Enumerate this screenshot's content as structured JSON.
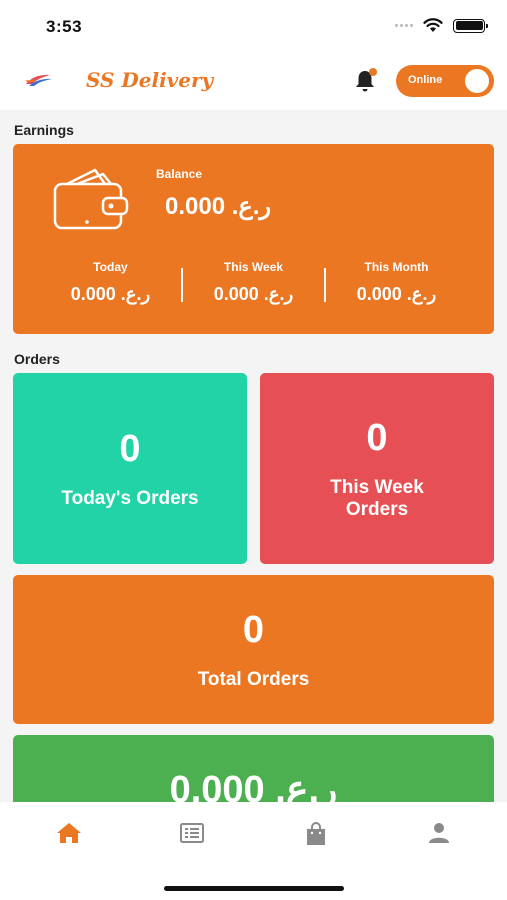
{
  "status_bar": {
    "time": "3:53"
  },
  "header": {
    "app_title": "SS Delivery",
    "online_toggle": {
      "label": "Online",
      "state": "on"
    },
    "notification_badge": true
  },
  "earnings": {
    "section_label": "Earnings",
    "balance_label": "Balance",
    "balance_value": "0.000 .ر.ع",
    "periods": [
      {
        "label": "Today",
        "value": "0.000 .ر.ع"
      },
      {
        "label": "This Week",
        "value": "0.000 .ر.ع"
      },
      {
        "label": "This Month",
        "value": "0.000 .ر.ع"
      }
    ]
  },
  "orders": {
    "section_label": "Orders",
    "todays": {
      "count": "0",
      "label": "Today's Orders"
    },
    "this_week": {
      "count": "0",
      "label_line1": "This Week",
      "label_line2": "Orders"
    },
    "total": {
      "count": "0",
      "label": "Total Orders"
    },
    "amount_card": {
      "value": "0.000 .ر.ع"
    }
  },
  "bottom_nav": {
    "items": [
      {
        "icon": "home-icon",
        "active": true
      },
      {
        "icon": "list-icon",
        "active": false
      },
      {
        "icon": "shopping-bag-icon",
        "active": false
      },
      {
        "icon": "profile-icon",
        "active": false
      }
    ]
  },
  "colors": {
    "accent_orange": "#ec7723",
    "teal": "#22d3a7",
    "red": "#e64f54",
    "green": "#4caf50",
    "background": "#f4f4f4",
    "nav_inactive": "#8a8a8a"
  }
}
